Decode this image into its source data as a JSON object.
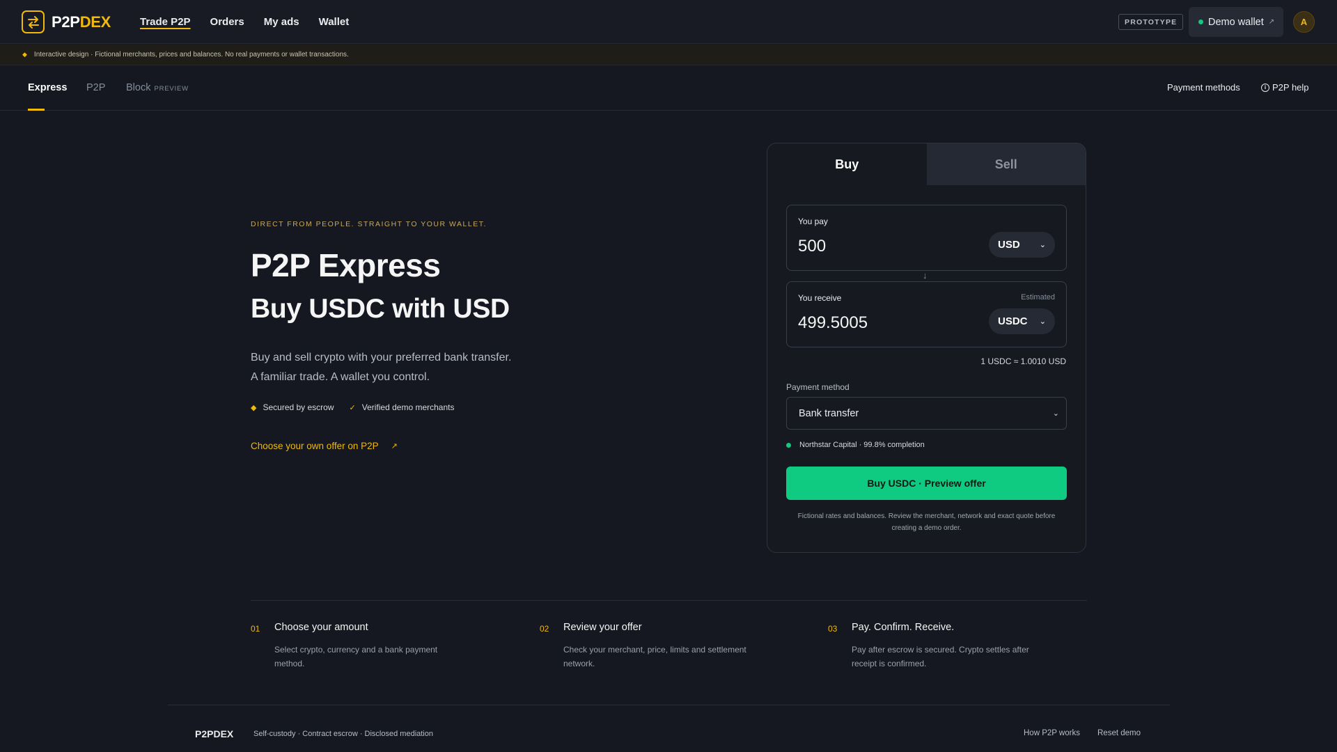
{
  "brand": {
    "name_a": "P2P",
    "name_b": "DEX",
    "footer_name": "P2PDEX"
  },
  "nav": {
    "items": [
      {
        "label": "Trade P2P",
        "active": true
      },
      {
        "label": "Orders"
      },
      {
        "label": "My ads"
      },
      {
        "label": "Wallet"
      }
    ],
    "badge": "PROTOTYPE",
    "wallet_label": "Demo wallet",
    "avatar_initial": "A"
  },
  "disclaimer": "Interactive design · Fictional merchants, prices and balances. No real payments or wallet transactions.",
  "subnav": {
    "tabs": [
      {
        "label": "Express",
        "active": true
      },
      {
        "label": "P2P"
      },
      {
        "label": "Block",
        "tag": "PREVIEW"
      }
    ],
    "payment_methods": "Payment methods",
    "help": "P2P help"
  },
  "hero": {
    "eyebrow": "DIRECT FROM PEOPLE. STRAIGHT TO YOUR WALLET.",
    "title": "P2P Express",
    "subtitle": "Buy USDC with USD",
    "desc_line1": "Buy and sell crypto with your preferred bank transfer.",
    "desc_line2": "A familiar trade. A wallet you control.",
    "feature1": "Secured by escrow",
    "feature2": "Verified demo merchants",
    "own_offer_link": "Choose your own offer on P2P"
  },
  "trade": {
    "tab_buy": "Buy",
    "tab_sell": "Sell",
    "pay_label": "You pay",
    "pay_value": "500",
    "pay_currency": "USD",
    "receive_label": "You receive",
    "receive_estimate": "Estimated",
    "receive_value": "499.5005",
    "receive_currency": "USDC",
    "rate": "1 USDC ≈ 1.0010 USD",
    "payment_label": "Payment method",
    "payment_value": "Bank transfer",
    "merchant": "Northstar Capital · 99.8% completion",
    "cta": "Buy USDC · Preview offer",
    "fine_print_line1": "Fictional rates and balances. Review the merchant, network and exact quote before",
    "fine_print_line2": "creating a demo order."
  },
  "steps": [
    {
      "num": "01",
      "title": "Choose your amount",
      "desc": "Select crypto, currency and a bank payment method."
    },
    {
      "num": "02",
      "title": "Review your offer",
      "desc": "Check your merchant, price, limits and settlement network."
    },
    {
      "num": "03",
      "title": "Pay. Confirm. Receive.",
      "desc": "Pay after escrow is secured. Crypto settles after receipt is confirmed."
    }
  ],
  "footer": {
    "tagline": "Self-custody · Contract escrow · Disclosed mediation",
    "link1": "How P2P works",
    "link2": "Reset demo"
  },
  "colors": {
    "accent": "#f0b90b",
    "success": "#0ecb81",
    "background": "#151820"
  },
  "icons": [
    "swap-logo-icon",
    "external-link-icon",
    "warning-diamond-icon",
    "info-icon",
    "chevron-down-icon",
    "arrow-down-icon",
    "check-icon"
  ]
}
